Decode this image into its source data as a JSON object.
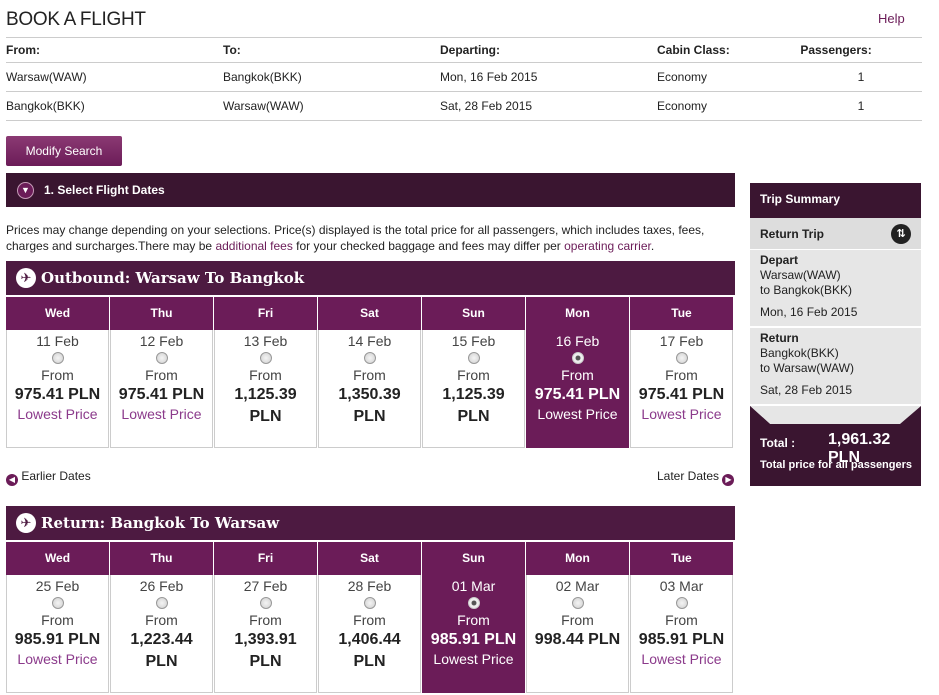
{
  "page": {
    "title": "BOOK A FLIGHT",
    "help": "Help"
  },
  "summary": {
    "headers": {
      "from": "From:",
      "to": "To:",
      "departing": "Departing:",
      "cabin": "Cabin Class:",
      "passengers": "Passengers:"
    },
    "rows": [
      {
        "from": "Warsaw(WAW)",
        "to": "Bangkok(BKK)",
        "departing": "Mon, 16 Feb 2015",
        "cabin": "Economy",
        "passengers": "1"
      },
      {
        "from": "Bangkok(BKK)",
        "to": "Warsaw(WAW)",
        "departing": "Sat, 28 Feb 2015",
        "cabin": "Economy",
        "passengers": "1"
      }
    ]
  },
  "modify_label": "Modify Search",
  "step": {
    "label": "1. Select Flight Dates"
  },
  "notice": {
    "part1": "Prices may change depending on your selections. Price(s) displayed is the total price for all passengers, which includes taxes, fees, charges and surcharges.There may be ",
    "link1": "additional fees",
    "part2": " for your checked baggage and fees may differ per ",
    "link2": "operating carrier",
    "part3": "."
  },
  "outbound": {
    "title": "Outbound: Warsaw To Bangkok",
    "days": [
      {
        "day": "Wed",
        "date": "11 Feb",
        "from": "From",
        "price": "975.41 PLN",
        "lowest": "Lowest Price"
      },
      {
        "day": "Thu",
        "date": "12 Feb",
        "from": "From",
        "price": "975.41 PLN",
        "lowest": "Lowest Price"
      },
      {
        "day": "Fri",
        "date": "13 Feb",
        "from": "From",
        "price": "1,125.39 PLN",
        "lowest": ""
      },
      {
        "day": "Sat",
        "date": "14 Feb",
        "from": "From",
        "price": "1,350.39 PLN",
        "lowest": ""
      },
      {
        "day": "Sun",
        "date": "15 Feb",
        "from": "From",
        "price": "1,125.39 PLN",
        "lowest": ""
      },
      {
        "day": "Mon",
        "date": "16 Feb",
        "from": "From",
        "price": "975.41 PLN",
        "lowest": "Lowest Price"
      },
      {
        "day": "Tue",
        "date": "17 Feb",
        "from": "From",
        "price": "975.41 PLN",
        "lowest": "Lowest Price"
      }
    ],
    "selected_index": 5
  },
  "nav": {
    "earlier": "Earlier Dates",
    "later": "Later Dates"
  },
  "return": {
    "title": "Return: Bangkok To Warsaw",
    "days": [
      {
        "day": "Wed",
        "date": "25 Feb",
        "from": "From",
        "price": "985.91 PLN",
        "lowest": "Lowest Price"
      },
      {
        "day": "Thu",
        "date": "26 Feb",
        "from": "From",
        "price": "1,223.44 PLN",
        "lowest": ""
      },
      {
        "day": "Fri",
        "date": "27 Feb",
        "from": "From",
        "price": "1,393.91 PLN",
        "lowest": ""
      },
      {
        "day": "Sat",
        "date": "28 Feb",
        "from": "From",
        "price": "1,406.44 PLN",
        "lowest": ""
      },
      {
        "day": "Sun",
        "date": "01 Mar",
        "from": "From",
        "price": "985.91 PLN",
        "lowest": "Lowest Price"
      },
      {
        "day": "Mon",
        "date": "02 Mar",
        "from": "From",
        "price": "998.44 PLN",
        "lowest": ""
      },
      {
        "day": "Tue",
        "date": "03 Mar",
        "from": "From",
        "price": "985.91 PLN",
        "lowest": "Lowest Price"
      }
    ],
    "selected_index": 4
  },
  "trip": {
    "title": "Trip Summary",
    "type": "Return Trip",
    "depart": {
      "label": "Depart",
      "from": "Warsaw(WAW)",
      "to": "to Bangkok(BKK)",
      "date": "Mon, 16 Feb 2015"
    },
    "ret": {
      "label": "Return",
      "from": "Bangkok(BKK)",
      "to": "to Warsaw(WAW)",
      "date": "Sat, 28 Feb 2015"
    },
    "total_label": "Total :",
    "total_amount": "1,961.32  PLN",
    "total_note": "Total price for all passengers"
  },
  "colors": {
    "brand": "#6b1c58",
    "dark": "#3a1530",
    "link": "#8b3a8b"
  },
  "icons": {
    "step": "chevron-down-icon",
    "plane": "plane-icon",
    "swap": "swap-icon",
    "nav": "arrow-circle-icon"
  }
}
